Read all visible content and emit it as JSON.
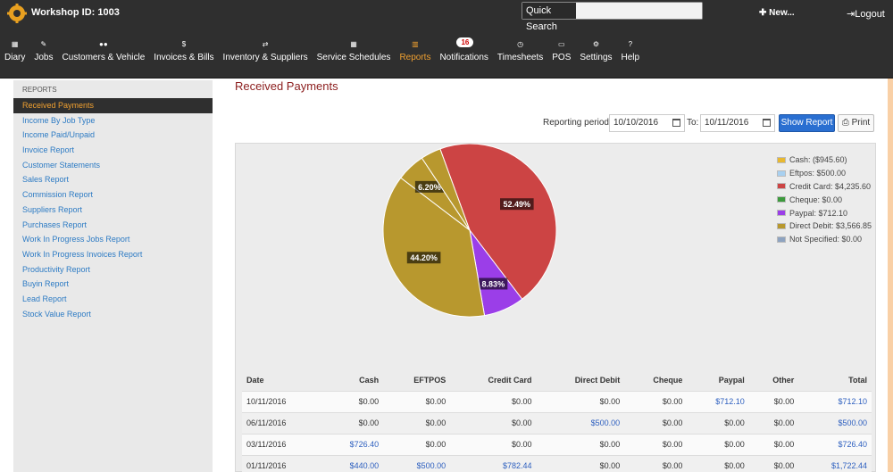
{
  "header": {
    "workshop_id": "Workshop ID: 1003",
    "quick_search_label": "Quick Search",
    "quick_search_value": "",
    "new_label": "New...",
    "logout_label": "Logout"
  },
  "nav": [
    {
      "label": "Diary",
      "icon": "calendar-icon"
    },
    {
      "label": "Jobs",
      "icon": "wrench-icon"
    },
    {
      "label": "Customers & Vehicle",
      "icon": "users-icon"
    },
    {
      "label": "Invoices & Bills",
      "icon": "dollar-icon"
    },
    {
      "label": "Inventory & Suppliers",
      "icon": "exchange-icon"
    },
    {
      "label": "Service Schedules",
      "icon": "calendar-icon"
    },
    {
      "label": "Reports",
      "icon": "chart-icon",
      "active": true
    },
    {
      "label": "Notifications",
      "icon": "info-icon",
      "badge": "16"
    },
    {
      "label": "Timesheets",
      "icon": "clock-icon"
    },
    {
      "label": "POS",
      "icon": "pos-icon"
    },
    {
      "label": "Settings",
      "icon": "gears-icon"
    },
    {
      "label": "Help",
      "icon": "question-icon"
    }
  ],
  "sidebar": {
    "title": "REPORTS",
    "items": [
      "Received Payments",
      "Income By Job Type",
      "Income Paid/Unpaid",
      "Invoice Report",
      "Customer Statements",
      "Sales Report",
      "Commission Report",
      "Suppliers Report",
      "Purchases Report",
      "Work In Progress Jobs Report",
      "Work In Progress Invoices Report",
      "Productivity Report",
      "Buyin Report",
      "Lead Report",
      "Stock Value Report"
    ],
    "active_index": 0
  },
  "main": {
    "title": "Received Payments",
    "period_label": "Reporting period:",
    "date_from": "10/10/2016",
    "to_label": "To:",
    "date_to": "10/11/2016",
    "show_report_label": "Show Report",
    "print_label": "Print"
  },
  "legend": [
    {
      "label": "Cash: ($945.60)",
      "color": "#e8b830"
    },
    {
      "label": "Eftpos: $500.00",
      "color": "#a8d0f0"
    },
    {
      "label": "Credit Card: $4,235.60",
      "color": "#cc4444"
    },
    {
      "label": "Cheque: $0.00",
      "color": "#3d9a3d"
    },
    {
      "label": "Paypal: $712.10",
      "color": "#9b3ee8"
    },
    {
      "label": "Direct Debit: $3,566.85",
      "color": "#b8982e"
    },
    {
      "label": "Not Specified: $0.00",
      "color": "#8ea3c0"
    }
  ],
  "chart_data": {
    "type": "pie",
    "slices": [
      {
        "name": "Credit Card",
        "value": 52.49,
        "label": "52.49%",
        "color": "#cc4444"
      },
      {
        "name": "Paypal",
        "value": 8.83,
        "label": "8.83%",
        "color": "#9b3ee8"
      },
      {
        "name": "Direct Debit",
        "value": 44.2,
        "label": "44.20%",
        "color": "#b8982e"
      },
      {
        "name": "Eftpos",
        "value": 6.2,
        "label": "6.20%",
        "color": "#b8982e"
      },
      {
        "name": "Cash",
        "value": 4.36,
        "label": "",
        "color": "#b8982e"
      }
    ],
    "start_angle_deg": -20
  },
  "table": {
    "columns": [
      "Date",
      "Cash",
      "EFTPOS",
      "Credit Card",
      "Direct Debit",
      "Cheque",
      "Paypal",
      "Other",
      "Total"
    ],
    "rows": [
      [
        "10/11/2016",
        "$0.00",
        "$0.00",
        "$0.00",
        "$0.00",
        "$0.00",
        "$712.10",
        "$0.00",
        "$712.10"
      ],
      [
        "06/11/2016",
        "$0.00",
        "$0.00",
        "$0.00",
        "$500.00",
        "$0.00",
        "$0.00",
        "$0.00",
        "$500.00"
      ],
      [
        "03/11/2016",
        "$726.40",
        "$0.00",
        "$0.00",
        "$0.00",
        "$0.00",
        "$0.00",
        "$0.00",
        "$726.40"
      ],
      [
        "01/11/2016",
        "$440.00",
        "$500.00",
        "$782.44",
        "$0.00",
        "$0.00",
        "$0.00",
        "$0.00",
        "$1,722.44"
      ]
    ],
    "link_cells": [
      [
        0,
        6
      ],
      [
        0,
        8
      ],
      [
        1,
        4
      ],
      [
        1,
        8
      ],
      [
        2,
        1
      ],
      [
        2,
        8
      ],
      [
        3,
        1
      ],
      [
        3,
        2
      ],
      [
        3,
        3
      ],
      [
        3,
        8
      ]
    ]
  }
}
